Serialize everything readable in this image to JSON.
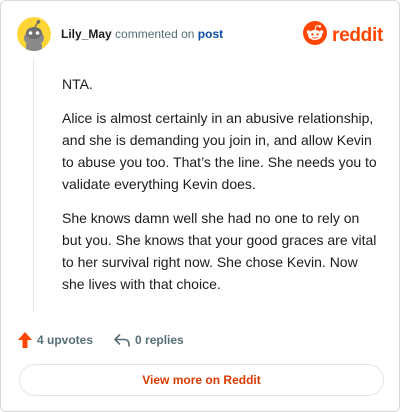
{
  "header": {
    "username": "Lily_May",
    "action_text": "commented on",
    "post_link_text": "post",
    "brand_word": "reddit"
  },
  "icons": {
    "avatar": "snoo-avatar-icon",
    "brand": "reddit-logo-icon",
    "upvote": "upvote-arrow-icon",
    "reply": "reply-arrow-icon"
  },
  "comment": {
    "paragraphs": [
      "NTA.",
      "Alice is almost certainly in an abusive relationship, and she is demanding you join in, and allow Kevin to abuse you too. That’s the line. She needs you to validate everything Kevin does.",
      "She knows damn well she had no one to rely on but you. She knows that your good graces are vital to her survival right now. She chose Kevin. Now she lives with that choice."
    ]
  },
  "actions": {
    "upvotes_label": "4 upvotes",
    "replies_label": "0 replies"
  },
  "footer": {
    "view_more_label": "View more on Reddit"
  },
  "colors": {
    "brand_orange": "#ff4500",
    "link_blue": "#0a4ea8",
    "view_more_text": "#d93900",
    "muted_text": "#576f76"
  }
}
